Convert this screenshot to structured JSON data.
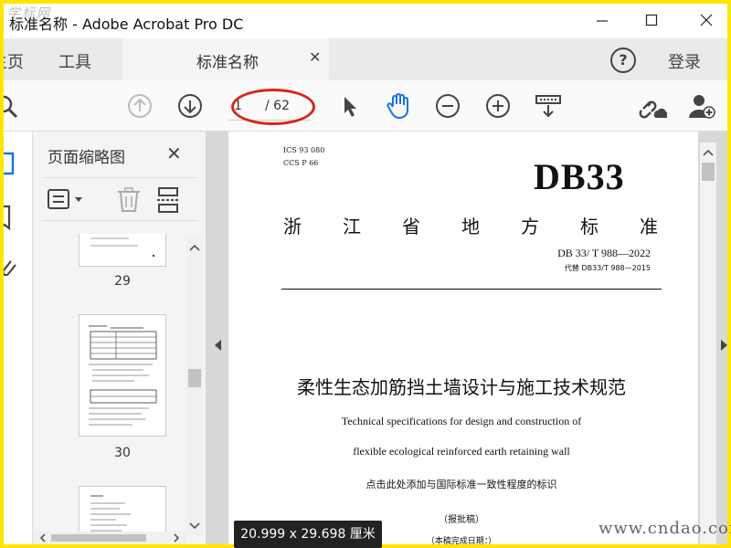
{
  "window": {
    "title": "标准名称 - Adobe Acrobat Pro DC",
    "watermark": "学标网"
  },
  "tabs": {
    "home": "主页",
    "tools": "工具",
    "doc": "标准名称",
    "login": "登录"
  },
  "toolbar": {
    "page_value": "1",
    "page_total": "/ 62"
  },
  "thumbnails": {
    "title": "页面缩略图",
    "pages": [
      "29",
      "30"
    ]
  },
  "document": {
    "ics": "ICS  93  080",
    "ccs": "CCS  P  66",
    "logo": "DB33",
    "province_chars": [
      "浙",
      "江",
      "省",
      "地",
      "方",
      "标",
      "准"
    ],
    "std_number": "DB 33/  T  988—2022",
    "replaces": "代替  DB33/T 988—2015",
    "title_cn": "柔性生态加筋挡土墙设计与施工技术规范",
    "title_en_1": "Technical specifications for design and construction of",
    "title_en_2": "flexible ecological reinforced earth retaining wall",
    "intl_note": "点击此处添加与国际标准一致性程度的标识",
    "draft": "（报批稿）",
    "completion": "（本稿完成日期：）"
  },
  "status": {
    "dimensions": "20.999 x 29.698 厘米"
  },
  "overlay": {
    "site": "www.cndao.com"
  },
  "colors": {
    "accent": "#1473e6",
    "highlight_circle": "#d9241c",
    "frame": "#ffe600"
  }
}
